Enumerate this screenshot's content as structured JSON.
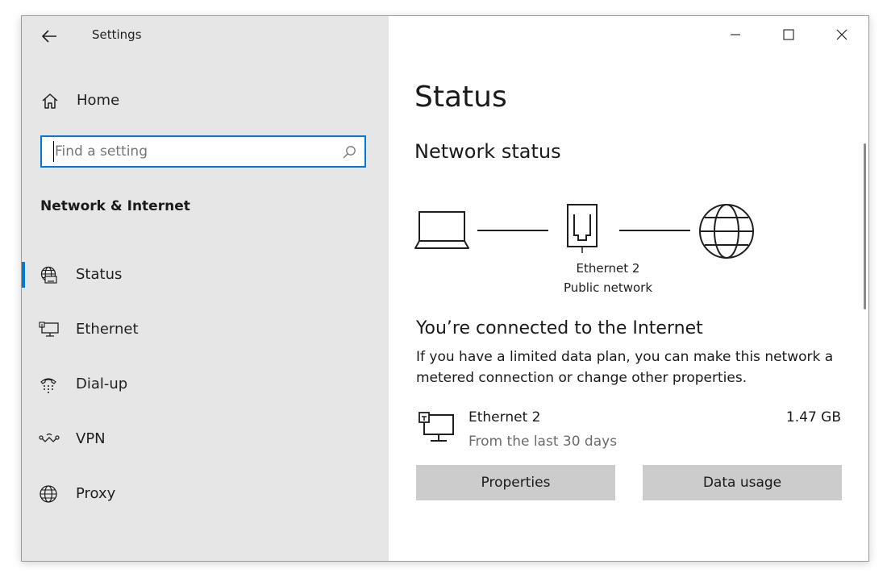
{
  "window": {
    "title": "Settings",
    "controls": {
      "minimize": "minimize",
      "maximize": "maximize",
      "close": "close"
    }
  },
  "sidebar": {
    "home_label": "Home",
    "search": {
      "placeholder": "Find a setting",
      "value": ""
    },
    "section_title": "Network & Internet",
    "items": [
      {
        "label": "Status",
        "icon": "globe-status-icon",
        "selected": true
      },
      {
        "label": "Ethernet",
        "icon": "ethernet-icon",
        "selected": false
      },
      {
        "label": "Dial-up",
        "icon": "dial-up-icon",
        "selected": false
      },
      {
        "label": "VPN",
        "icon": "vpn-icon",
        "selected": false
      },
      {
        "label": "Proxy",
        "icon": "globe-icon",
        "selected": false
      }
    ]
  },
  "main": {
    "page_title": "Status",
    "network_status_heading": "Network status",
    "diagram": {
      "adapter_name": "Ethernet 2",
      "network_type": "Public network"
    },
    "connection_heading": "You’re connected to the Internet",
    "connection_description": "If you have a limited data plan, you can make this network a metered connection or change other properties.",
    "adapter": {
      "name": "Ethernet 2",
      "usage_period": "From the last 30 days",
      "usage": "1.47 GB"
    },
    "buttons": {
      "properties": "Properties",
      "data_usage": "Data usage"
    }
  },
  "colors": {
    "accent": "#0078d7",
    "sidebar_bg": "#e6e6e6",
    "button_bg": "#cccccc"
  }
}
